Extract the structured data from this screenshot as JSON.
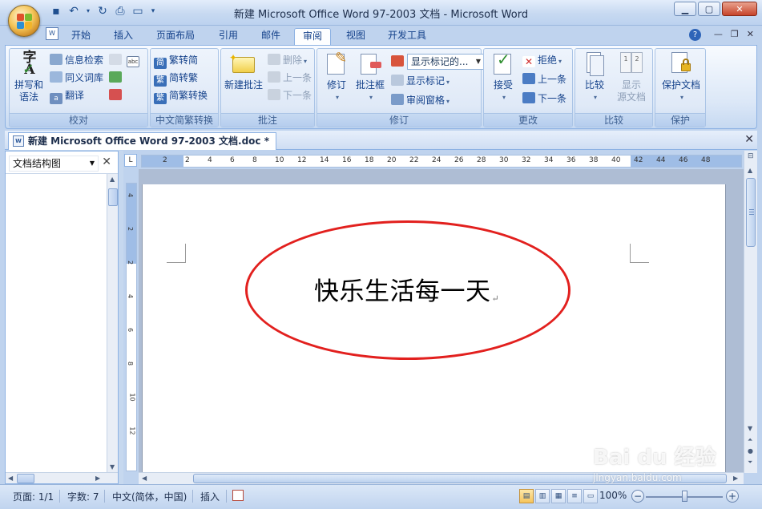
{
  "window": {
    "title": "新建 Microsoft Office Word 97-2003 文档 - Microsoft Word"
  },
  "tabs": [
    "开始",
    "插入",
    "页面布局",
    "引用",
    "邮件",
    "审阅",
    "视图",
    "开发工具"
  ],
  "active_tab": "审阅",
  "ribbon": {
    "proofing": {
      "label": "校对",
      "spelling": "拼写和\n语法",
      "research": "信息检索",
      "thesaurus": "同义词库",
      "translate": "翻译"
    },
    "chinese": {
      "label": "中文简繁转换",
      "to_simplified": "繁转简",
      "to_traditional": "简转繁",
      "convert": "简繁转换"
    },
    "comments": {
      "label": "批注",
      "new_comment": "新建批注",
      "delete": "删除",
      "previous": "上一条",
      "next": "下一条"
    },
    "tracking": {
      "label": "修订",
      "track_changes": "修订",
      "balloons": "批注框",
      "display_combo": "显示标记的...",
      "show_markup": "显示标记",
      "reviewing_pane": "审阅窗格"
    },
    "changes": {
      "label": "更改",
      "accept": "接受",
      "reject": "拒绝",
      "previous": "上一条",
      "next": "下一条"
    },
    "compare": {
      "label": "比较",
      "compare": "比较",
      "show_source": "显示\n源文档"
    },
    "protect": {
      "label": "保护",
      "protect_document": "保护文档"
    }
  },
  "document_tab": {
    "title": "新建 Microsoft Office Word 97-2003 文档.doc *"
  },
  "nav_pane": {
    "selected_view": "文档结构图"
  },
  "ruler": {
    "h_labels": [
      "2",
      "2",
      "4",
      "6",
      "8",
      "10",
      "12",
      "14",
      "16",
      "18",
      "20",
      "22",
      "24",
      "26",
      "28",
      "30",
      "32",
      "34",
      "36",
      "38",
      "40",
      "42",
      "44",
      "46",
      "48"
    ],
    "v_labels": [
      "4",
      "2",
      "2",
      "4",
      "6",
      "8",
      "10",
      "12"
    ]
  },
  "document": {
    "text": "快乐生活每一天",
    "paragraph_mark": "↵"
  },
  "status": {
    "page": "页面: 1/1",
    "words": "字数: 7",
    "language": "中文(简体，中国)",
    "mode": "插入",
    "zoom": "100%"
  },
  "watermark": {
    "brand": "Bai du 经验",
    "url": "jingyan.baidu.com"
  },
  "colors": {
    "accent": "#e2201e",
    "ribbon_text": "#15428b"
  }
}
